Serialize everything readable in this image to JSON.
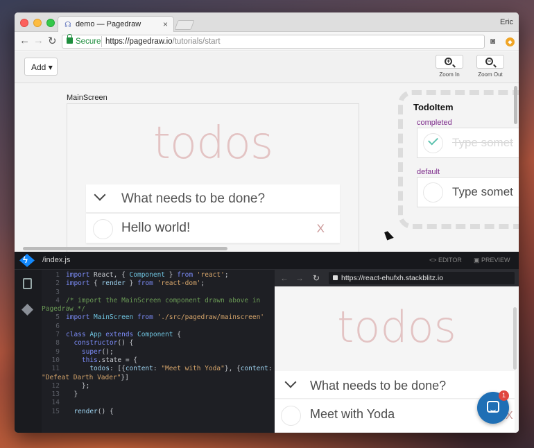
{
  "browser": {
    "tab_title": "demo — Pagedraw",
    "profile_name": "Eric",
    "secure_label": "Secure",
    "url_host": "https://pagedraw.io",
    "url_path": "/tutorials/start"
  },
  "editor": {
    "add_label": "Add",
    "zoom_in_label": "Zoom In",
    "zoom_out_label": "Zoom Out",
    "artboard_name": "MainScreen",
    "todos_title": "todos",
    "new_todo_placeholder": "What needs to be done?",
    "todo_item_text": "Hello world!",
    "delete_glyph": "X",
    "component_name": "TodoItem",
    "states": [
      {
        "label": "completed",
        "text": "Type somet"
      },
      {
        "label": "default",
        "text": "Type somet"
      }
    ]
  },
  "stackblitz": {
    "file_path": "/index.js",
    "editor_tab": "EDITOR",
    "preview_tab": "PREVIEW",
    "preview_url": "https://react-ehufxh.stackblitz.io",
    "code_lines": [
      {
        "n": "1",
        "t": "import React, { Component } from 'react';"
      },
      {
        "n": "2",
        "t": "import { render } from 'react-dom';"
      },
      {
        "n": "3",
        "t": ""
      },
      {
        "n": "4",
        "t": "/* import the MainScreen component drawn above in"
      },
      {
        "n": "",
        "t": "Pagedraw */"
      },
      {
        "n": "5",
        "t": "import MainScreen from './src/pagedraw/mainscreen'"
      },
      {
        "n": "6",
        "t": ""
      },
      {
        "n": "7",
        "t": "class App extends Component {"
      },
      {
        "n": "8",
        "t": "  constructor() {"
      },
      {
        "n": "9",
        "t": "    super();"
      },
      {
        "n": "10",
        "t": "    this.state = {"
      },
      {
        "n": "11",
        "t": "      todos: [{content: \"Meet with Yoda\"}, {content:"
      },
      {
        "n": "",
        "t": "\"Defeat Darth Vader\"}]"
      },
      {
        "n": "12",
        "t": "    };"
      },
      {
        "n": "13",
        "t": "  }"
      },
      {
        "n": "14",
        "t": ""
      },
      {
        "n": "15",
        "t": "  render() {"
      }
    ],
    "preview": {
      "todos_title": "todos",
      "new_todo_placeholder": "What needs to be done?",
      "todo_item_text": "Meet with Yoda",
      "delete_glyph": "X"
    }
  },
  "chat": {
    "badge_count": "1"
  },
  "colors": {
    "secure_green": "#1e8e3e",
    "stackblitz_blue": "#1389fd",
    "chat_blue": "#1f6fb5"
  }
}
